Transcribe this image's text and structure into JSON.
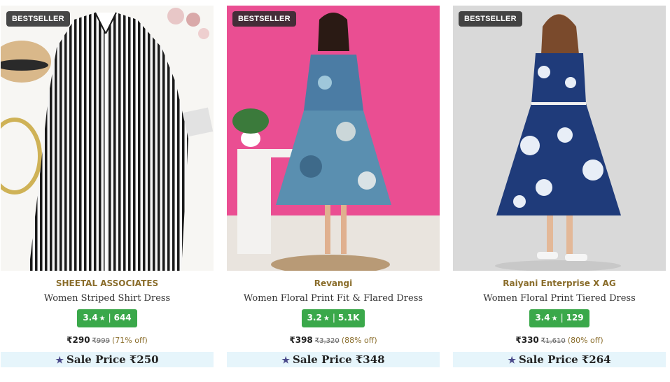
{
  "products": [
    {
      "badge": "BESTSELLER",
      "brand": "SHEETAL ASSOCIATES",
      "title": "Women Striped Shirt Dress",
      "rating": "3.4",
      "rating_count": "644",
      "price": "₹290",
      "mrp": "₹999",
      "discount": "(71% off)",
      "sale_label": "Sale Price ₹250"
    },
    {
      "badge": "BESTSELLER",
      "brand": "Revangi",
      "title": "Women Floral Print Fit & Flared Dress",
      "rating": "3.2",
      "rating_count": "5.1K",
      "price": "₹398",
      "mrp": "₹3,320",
      "discount": "(88% off)",
      "sale_label": "Sale Price ₹348"
    },
    {
      "badge": "BESTSELLER",
      "brand": "Raiyani Enterprise X AG",
      "title": "Women Floral Print Tiered Dress",
      "rating": "3.4",
      "rating_count": "129",
      "price": "₹330",
      "mrp": "₹1,610",
      "discount": "(80% off)",
      "sale_label": "Sale Price ₹264"
    }
  ],
  "icons": {
    "rating_star": "★",
    "sale_star": "★"
  },
  "colors": {
    "brand_text": "#8a6d2b",
    "rating_bg": "#3aa84a",
    "sale_bg": "#e6f5fb",
    "badge_bg": "#282828"
  }
}
